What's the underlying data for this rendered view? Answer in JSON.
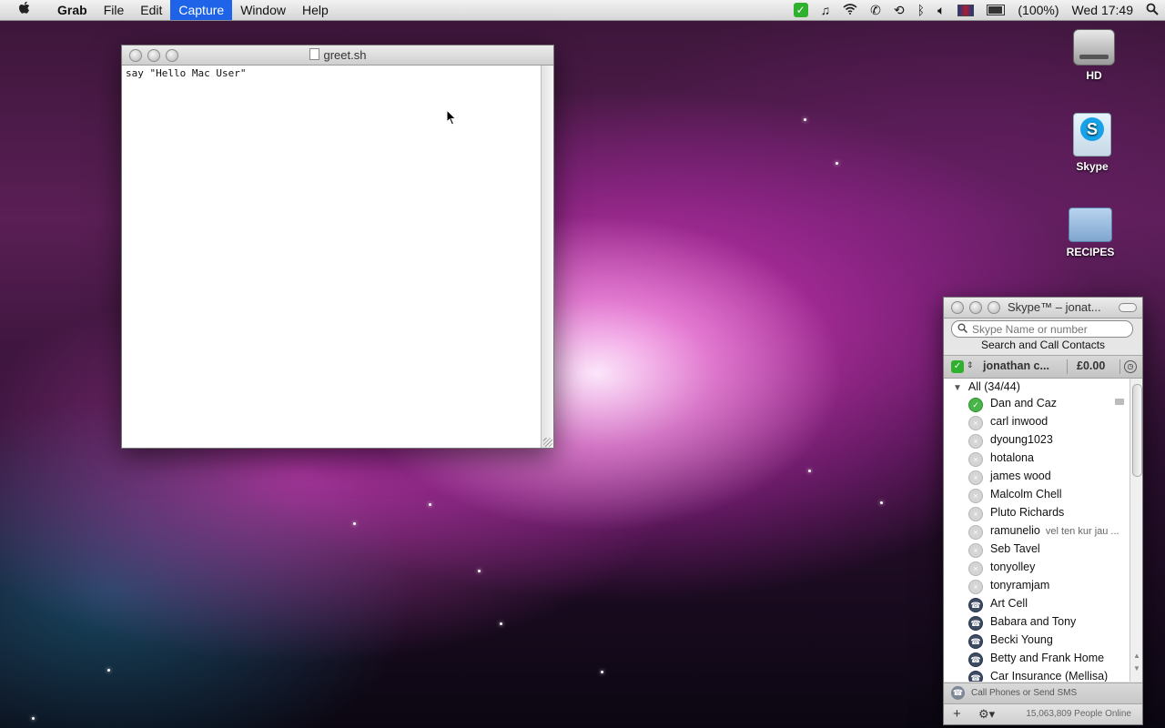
{
  "menubar": {
    "apple": "",
    "app": "Grab",
    "items": [
      "File",
      "Edit",
      "Capture",
      "Window",
      "Help"
    ],
    "active": "Capture",
    "status": {
      "battery": "(100%)",
      "clock": "Wed 17:49"
    }
  },
  "desktop": {
    "icons": [
      {
        "label": "HD",
        "icon": "hard-drive-icon"
      },
      {
        "label": "Skype",
        "icon": "skype-app-icon"
      },
      {
        "label": "RECIPES",
        "icon": "folder-icon"
      }
    ]
  },
  "editor": {
    "title": "greet.sh",
    "content": "say \"Hello Mac User\""
  },
  "skype": {
    "title": "Skype™ – jonat...",
    "search_placeholder": "Skype Name or number",
    "search_call_label": "Search and Call Contacts",
    "account_name": "jonathan c...",
    "credit": "£0.00",
    "group_label": "All (34/44)",
    "contacts": [
      {
        "name": "Dan and Caz",
        "status": "online",
        "mood": "",
        "video": true
      },
      {
        "name": "carl inwood",
        "status": "offline",
        "mood": ""
      },
      {
        "name": "dyoung1023",
        "status": "offline",
        "mood": ""
      },
      {
        "name": "hotalona",
        "status": "offline",
        "mood": ""
      },
      {
        "name": "james wood",
        "status": "offline",
        "mood": ""
      },
      {
        "name": "Malcolm Chell",
        "status": "offline",
        "mood": ""
      },
      {
        "name": "Pluto Richards",
        "status": "offline",
        "mood": ""
      },
      {
        "name": "ramunelio",
        "status": "offline",
        "mood": "vel ten kur jau ..."
      },
      {
        "name": "Seb Tavel",
        "status": "offline",
        "mood": ""
      },
      {
        "name": "tonyolley",
        "status": "offline",
        "mood": ""
      },
      {
        "name": "tonyramjam",
        "status": "offline",
        "mood": ""
      },
      {
        "name": "Art Cell",
        "status": "phone",
        "mood": ""
      },
      {
        "name": "Babara and Tony",
        "status": "phone",
        "mood": ""
      },
      {
        "name": "Becki Young",
        "status": "phone",
        "mood": ""
      },
      {
        "name": "Betty and Frank Home",
        "status": "phone",
        "mood": ""
      },
      {
        "name": "Car Insurance (Mellisa)",
        "status": "phone",
        "mood": ""
      }
    ],
    "call_bar_label": "Call Phones or Send SMS",
    "people_online": "15,063,809 People Online"
  }
}
